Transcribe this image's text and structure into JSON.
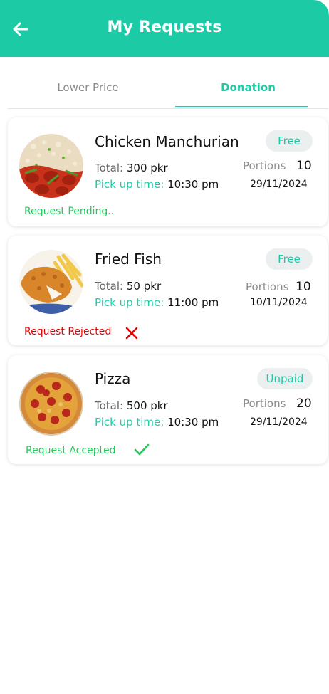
{
  "header": {
    "title": "My Requests"
  },
  "tabs": [
    {
      "label": "Lower Price",
      "active": false
    },
    {
      "label": "Donation",
      "active": true
    }
  ],
  "requests": [
    {
      "name": "Chicken Manchurian",
      "badge": "Free",
      "total_label": "Total:",
      "total_value": "300 pkr",
      "pickup_label": "Pick up time:",
      "pickup_value": "10:30 pm",
      "portions_label": "Portions",
      "portions_value": "10",
      "date": "29/11/2024",
      "status": "Request Pending..",
      "image_icon": "chicken-manchurian-dish"
    },
    {
      "name": "Fried Fish",
      "badge": "Free",
      "total_label": "Total:",
      "total_value": "50 pkr",
      "pickup_label": "Pick up time:",
      "pickup_value": "11:00 pm",
      "portions_label": "Portions",
      "portions_value": "10",
      "date": "10/11/2024",
      "status": "Request Rejected",
      "status_icon": "cross-icon",
      "image_icon": "fried-fish-dish"
    },
    {
      "name": "Pizza",
      "badge": "Unpaid",
      "total_label": "Total:",
      "total_value": "500 pkr",
      "pickup_label": "Pick up time:",
      "pickup_value": "10:30 pm",
      "portions_label": "Portions",
      "portions_value": "20",
      "date": "29/11/2024",
      "status": "Request Accepted",
      "status_icon": "check-icon",
      "image_icon": "pizza-dish"
    }
  ],
  "colors": {
    "accent": "#1ccaa6",
    "pending": "#22c95d",
    "rejected": "#e60000",
    "accepted": "#22c95d"
  }
}
